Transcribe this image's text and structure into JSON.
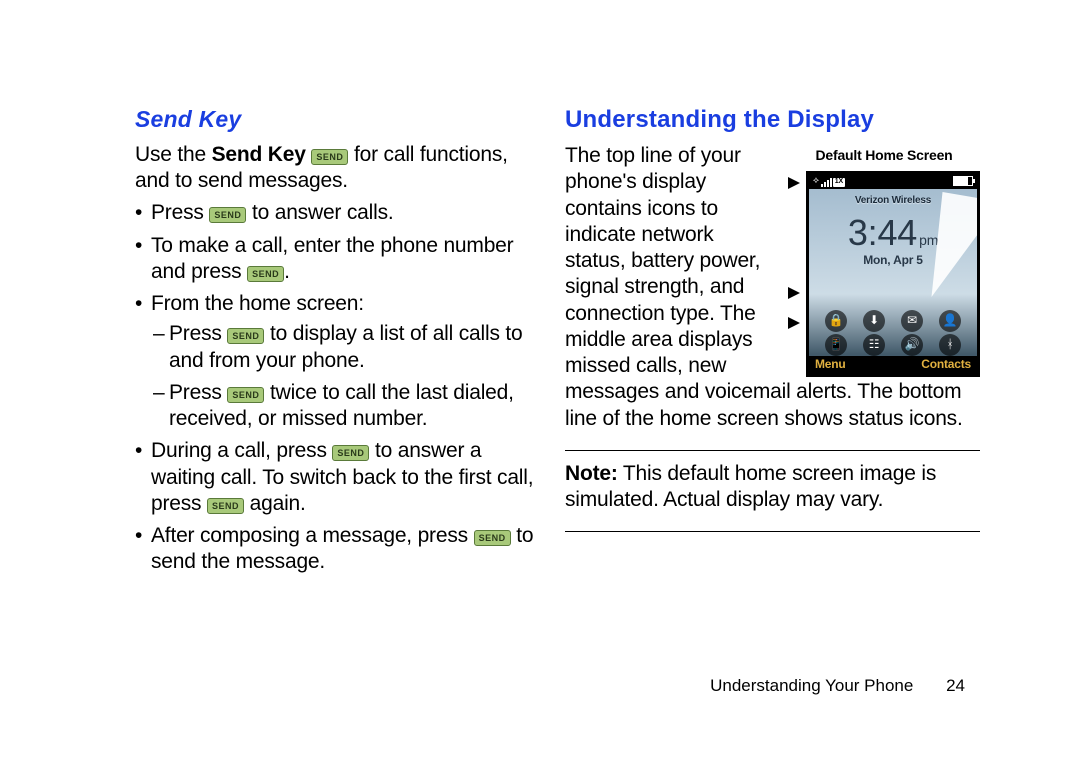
{
  "left": {
    "heading": "Send Key",
    "intro_a": "Use the ",
    "intro_b": "Send Key",
    "intro_c": " for call functions, and to send messages.",
    "send_label": "SEND",
    "b1_a": "Press ",
    "b1_b": " to answer calls.",
    "b2_a": "To make a call, enter the phone number and press ",
    "b2_b": ".",
    "b3": "From the home screen:",
    "s1_a": "Press ",
    "s1_b": " to display a list of all calls to and from your phone.",
    "s2_a": "Press ",
    "s2_b": " twice to call the last dialed, received, or missed number.",
    "b4_a": "During a call, press ",
    "b4_b": " to answer a waiting call. To switch back to the first call, press ",
    "b4_c": " again.",
    "b5_a": "After composing a message, press ",
    "b5_b": " to send the message."
  },
  "right": {
    "heading": "Understanding the Display",
    "caption": "Default Home Screen",
    "para": "The top line of your phone's display contains icons to indicate network status, battery power, signal strength, and connection type. The middle area displays missed calls, new messages and voicemail alerts. The bottom line of the home screen shows status icons.",
    "note_label": "Note:",
    "note_text": " This default home screen image is simulated. Actual display may vary."
  },
  "phone": {
    "carrier": "Verizon Wireless",
    "time": "3:44",
    "ampm": "pm",
    "date": "Mon, Apr 5",
    "onex": "1X",
    "sk_left": "Menu",
    "sk_right": "Contacts"
  },
  "footer": {
    "section": "Understanding Your Phone",
    "page": "24"
  }
}
